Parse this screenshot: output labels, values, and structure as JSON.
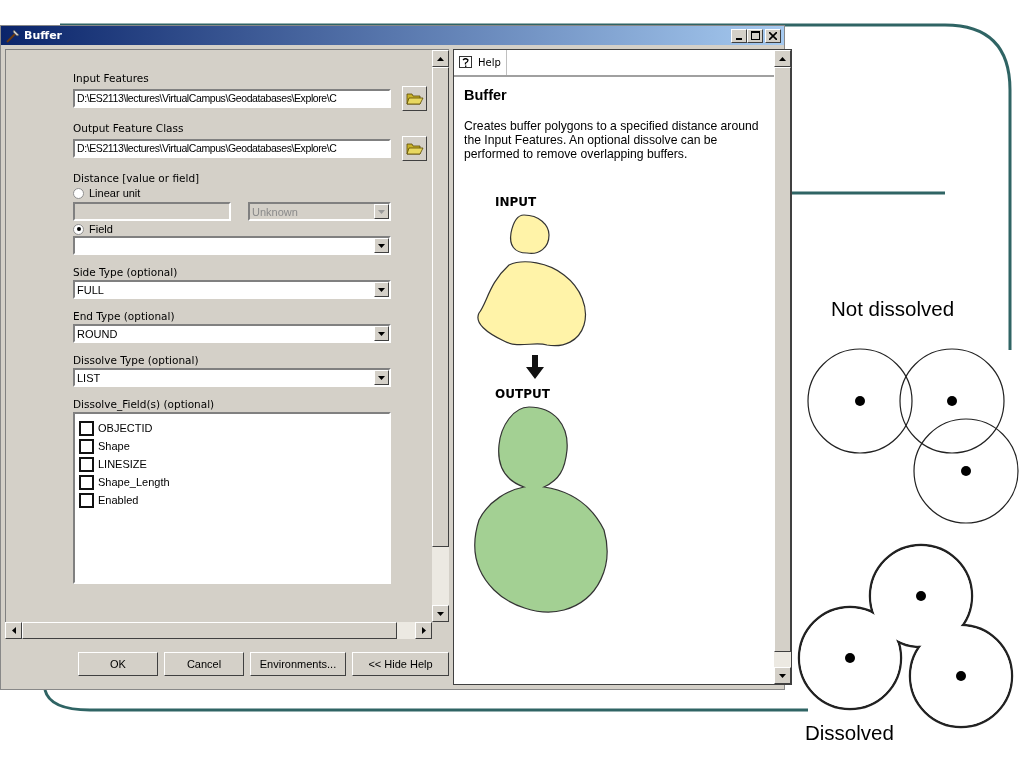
{
  "window": {
    "title": "Buffer"
  },
  "parameters": [
    {
      "kind": "path",
      "label": "Input Features",
      "value": "D:\\ES2113\\lectures\\VirtualCampus\\Geodatabases\\Explore\\C"
    },
    {
      "kind": "path",
      "label": "Output Feature Class",
      "value": "D:\\ES2113\\lectures\\VirtualCampus\\Geodatabases\\Explore\\C"
    },
    {
      "kind": "distance",
      "label": "Distance [value or field]",
      "linear_unit": {
        "label": "Linear unit",
        "selected": false,
        "unit": "Unknown",
        "disabled": true
      },
      "field": {
        "label": "Field",
        "selected": true
      }
    },
    {
      "kind": "dropdown",
      "label": "Side Type (optional)",
      "value": "FULL"
    },
    {
      "kind": "dropdown",
      "label": "End Type (optional)",
      "value": "ROUND"
    },
    {
      "kind": "dropdown",
      "label": "Dissolve Type (optional)",
      "value": "LIST"
    },
    {
      "kind": "checklist",
      "label": "Dissolve_Field(s) (optional)",
      "items": [
        {
          "label": "OBJECTID",
          "checked": false
        },
        {
          "label": "Shape",
          "checked": false
        },
        {
          "label": "LINESIZE",
          "checked": false
        },
        {
          "label": "Shape_Length",
          "checked": false
        },
        {
          "label": "Enabled",
          "checked": false
        }
      ]
    }
  ],
  "buttons": [
    {
      "label": "OK"
    },
    {
      "label": "Cancel"
    },
    {
      "label": "Environments..."
    },
    {
      "label": "<< Hide Help"
    }
  ],
  "help": {
    "tab": "Help",
    "title": "Buffer",
    "description": "Creates buffer polygons to a specified distance around the Input Features. An optional dissolve can be performed to remove overlapping buffers.",
    "input_label": "INPUT",
    "output_label": "OUTPUT"
  },
  "slide": {
    "not_dissolved_label": "Not dissolved",
    "dissolved_label": "Dissolved"
  }
}
